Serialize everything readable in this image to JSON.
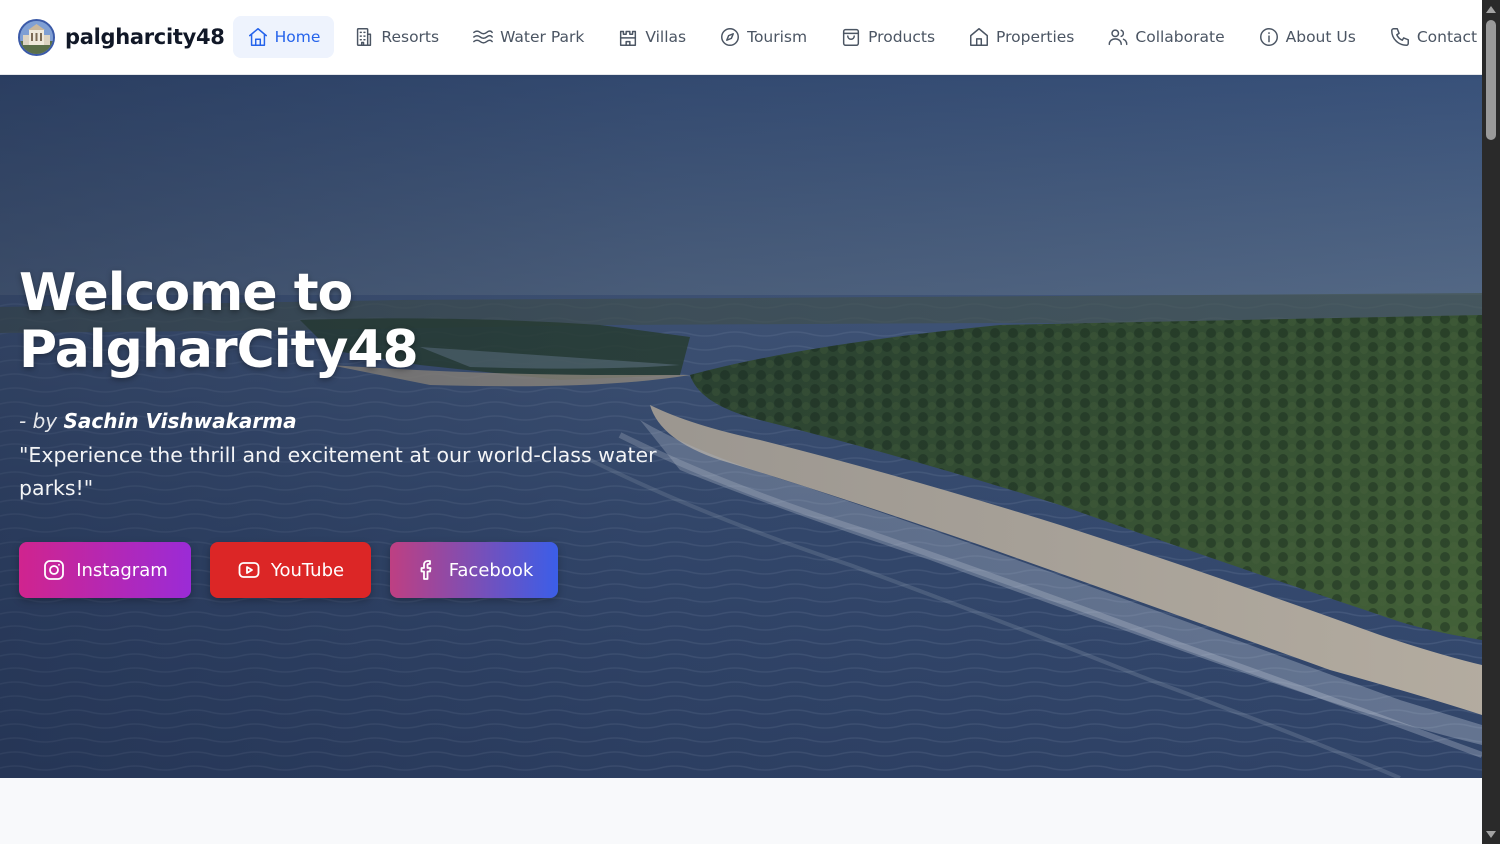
{
  "brand": {
    "name": "palgharcity48",
    "logo_icon": "city-building-logo"
  },
  "nav": {
    "items": [
      {
        "label": "Home",
        "icon": "home-icon",
        "active": true
      },
      {
        "label": "Resorts",
        "icon": "building-icon",
        "active": false
      },
      {
        "label": "Water Park",
        "icon": "waves-icon",
        "active": false
      },
      {
        "label": "Villas",
        "icon": "castle-icon",
        "active": false
      },
      {
        "label": "Tourism",
        "icon": "compass-icon",
        "active": false
      },
      {
        "label": "Products",
        "icon": "shopping-bag-icon",
        "active": false
      },
      {
        "label": "Properties",
        "icon": "house-icon",
        "active": false
      },
      {
        "label": "Collaborate",
        "icon": "users-icon",
        "active": false
      },
      {
        "label": "About Us",
        "icon": "info-icon",
        "active": false
      },
      {
        "label": "Contact",
        "icon": "phone-icon",
        "active": false
      }
    ],
    "active_color": "#2563eb"
  },
  "hero": {
    "title_line1": "Welcome to",
    "title_line2": "PalgharCity48",
    "byline_prefix": "- by",
    "byline_author": "Sachin Vishwakarma",
    "quote": "\"Experience the thrill and excitement at our world-class water parks!\"",
    "buttons": {
      "instagram": {
        "label": "Instagram",
        "icon": "instagram-icon"
      },
      "youtube": {
        "label": "YouTube",
        "icon": "youtube-icon",
        "color": "#dc2626"
      },
      "facebook": {
        "label": "Facebook",
        "icon": "facebook-icon"
      }
    }
  }
}
